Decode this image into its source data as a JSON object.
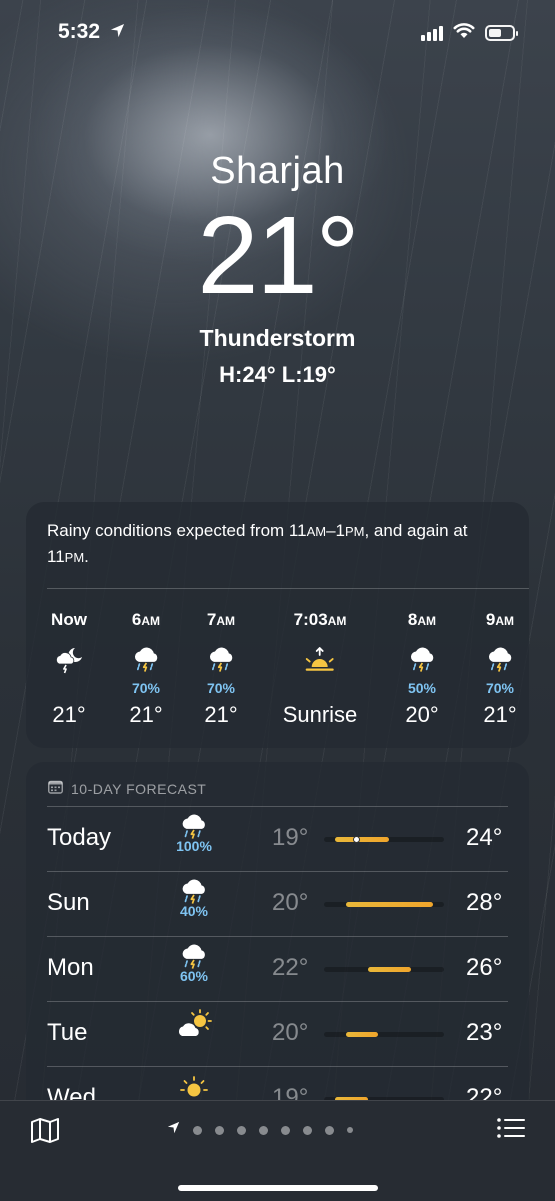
{
  "status_bar": {
    "time": "5:32",
    "location_icon": "location-arrow-icon",
    "signal_icon": "cellular-signal-icon",
    "wifi_icon": "wifi-icon",
    "battery_icon": "battery-icon"
  },
  "current": {
    "city": "Sharjah",
    "temperature": "21°",
    "condition": "Thunderstorm",
    "hi_lo": "H:24°  L:19°"
  },
  "hourly": {
    "description_part1": "Rainy conditions expected from 11",
    "description": "Rainy conditions expected from 11AM–1PM, and again at 11PM.",
    "hours": [
      {
        "label": "Now",
        "suffix": "",
        "icon": "moon-cloud-lightning-icon",
        "precip": "",
        "temp": "21°"
      },
      {
        "label": "6",
        "suffix": "AM",
        "icon": "cloud-bolt-rain-icon",
        "precip": "70%",
        "temp": "21°"
      },
      {
        "label": "7",
        "suffix": "AM",
        "icon": "cloud-bolt-rain-icon",
        "precip": "70%",
        "temp": "21°"
      },
      {
        "label": "7:03",
        "suffix": "AM",
        "icon": "sunrise-icon",
        "precip": "",
        "temp": "Sunrise"
      },
      {
        "label": "8",
        "suffix": "AM",
        "icon": "cloud-bolt-rain-icon",
        "precip": "50%",
        "temp": "20°"
      },
      {
        "label": "9",
        "suffix": "AM",
        "icon": "cloud-bolt-rain-icon",
        "precip": "70%",
        "temp": "21°"
      }
    ]
  },
  "forecast": {
    "heading": "10-DAY FORECAST",
    "range_min": 18,
    "range_max": 29,
    "days": [
      {
        "day": "Today",
        "icon": "cloud-bolt-rain-icon",
        "precip": "100%",
        "low": "19°",
        "high": "24°",
        "low_val": 19,
        "high_val": 24,
        "current_val": 21
      },
      {
        "day": "Sun",
        "icon": "cloud-bolt-rain-icon",
        "precip": "40%",
        "low": "20°",
        "high": "28°",
        "low_val": 20,
        "high_val": 28
      },
      {
        "day": "Mon",
        "icon": "cloud-bolt-rain-icon",
        "precip": "60%",
        "low": "22°",
        "high": "26°",
        "low_val": 22,
        "high_val": 26
      },
      {
        "day": "Tue",
        "icon": "sun-cloud-icon",
        "precip": "",
        "low": "20°",
        "high": "23°",
        "low_val": 20,
        "high_val": 23
      },
      {
        "day": "Wed",
        "icon": "sun-icon",
        "precip": "",
        "low": "19°",
        "high": "22°",
        "low_val": 19,
        "high_val": 22
      }
    ]
  },
  "bottom_bar": {
    "map_icon": "map-icon",
    "list_icon": "list-icon",
    "pages": 9,
    "active_page": 0
  }
}
